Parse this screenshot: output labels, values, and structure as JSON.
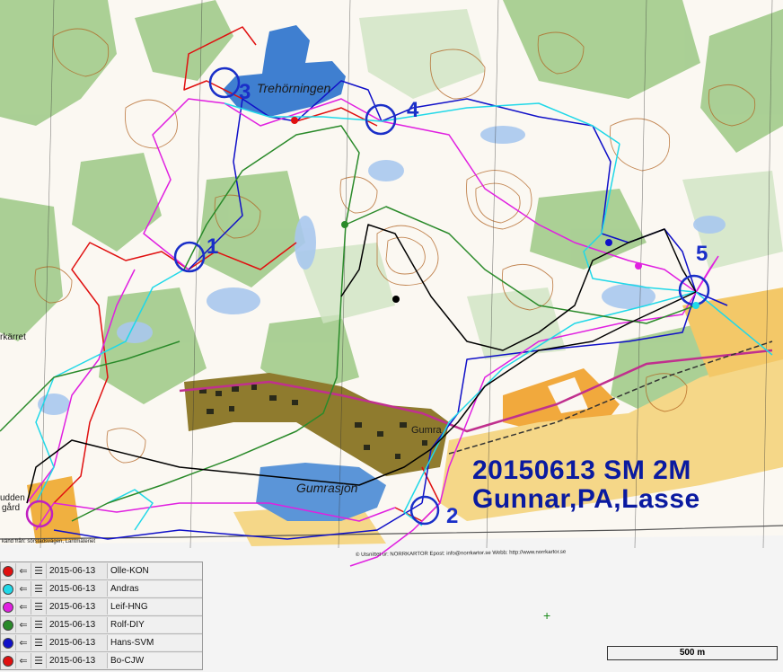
{
  "map": {
    "title_line1": "20150613 SM 2M",
    "title_line2": "Gunnar,PA,Lasse",
    "lake_labels": [
      "Trehörningen",
      "Gumrasjön"
    ],
    "place_labels": [
      "Gumra",
      "rkärret",
      "udden",
      "gård"
    ],
    "credit": "© Utsnittet ur: NORRKARTOR   Epost: info@norrkartor.se   Webb: http://www.norrkartor.se",
    "credit_left": "känd från: sörstadsvägen, Lantmäteriet",
    "controls": [
      "1",
      "2",
      "3",
      "4",
      "5"
    ],
    "colors": {
      "water": "#3f7fd0",
      "forest_green": "#93c27a",
      "open_land": "#f3d47c",
      "field_yellow": "#f0b040",
      "contour": "#b0601e",
      "control_circle": "#1a2fc8",
      "route_red": "#e01010",
      "route_blue": "#1010c8",
      "route_magenta": "#e020e0",
      "route_cyan": "#20d8e8",
      "route_green": "#2a8a2a",
      "route_black": "#000000"
    }
  },
  "legend": {
    "rows": [
      {
        "date": "2015-06-13",
        "name": "Olle-KON",
        "color": "#e01010"
      },
      {
        "date": "2015-06-13",
        "name": "Andras",
        "color": "#20d8e8"
      },
      {
        "date": "2015-06-13",
        "name": "Leif-HNG",
        "color": "#e020e0"
      },
      {
        "date": "2015-06-13",
        "name": "Rolf-DIY",
        "color": "#2a8a2a"
      },
      {
        "date": "2015-06-13",
        "name": "Hans-SVM",
        "color": "#1010c8"
      },
      {
        "date": "2015-06-13",
        "name": "Bo-CJW",
        "color": "#e01010"
      }
    ]
  },
  "scale": {
    "label": "500 m"
  }
}
